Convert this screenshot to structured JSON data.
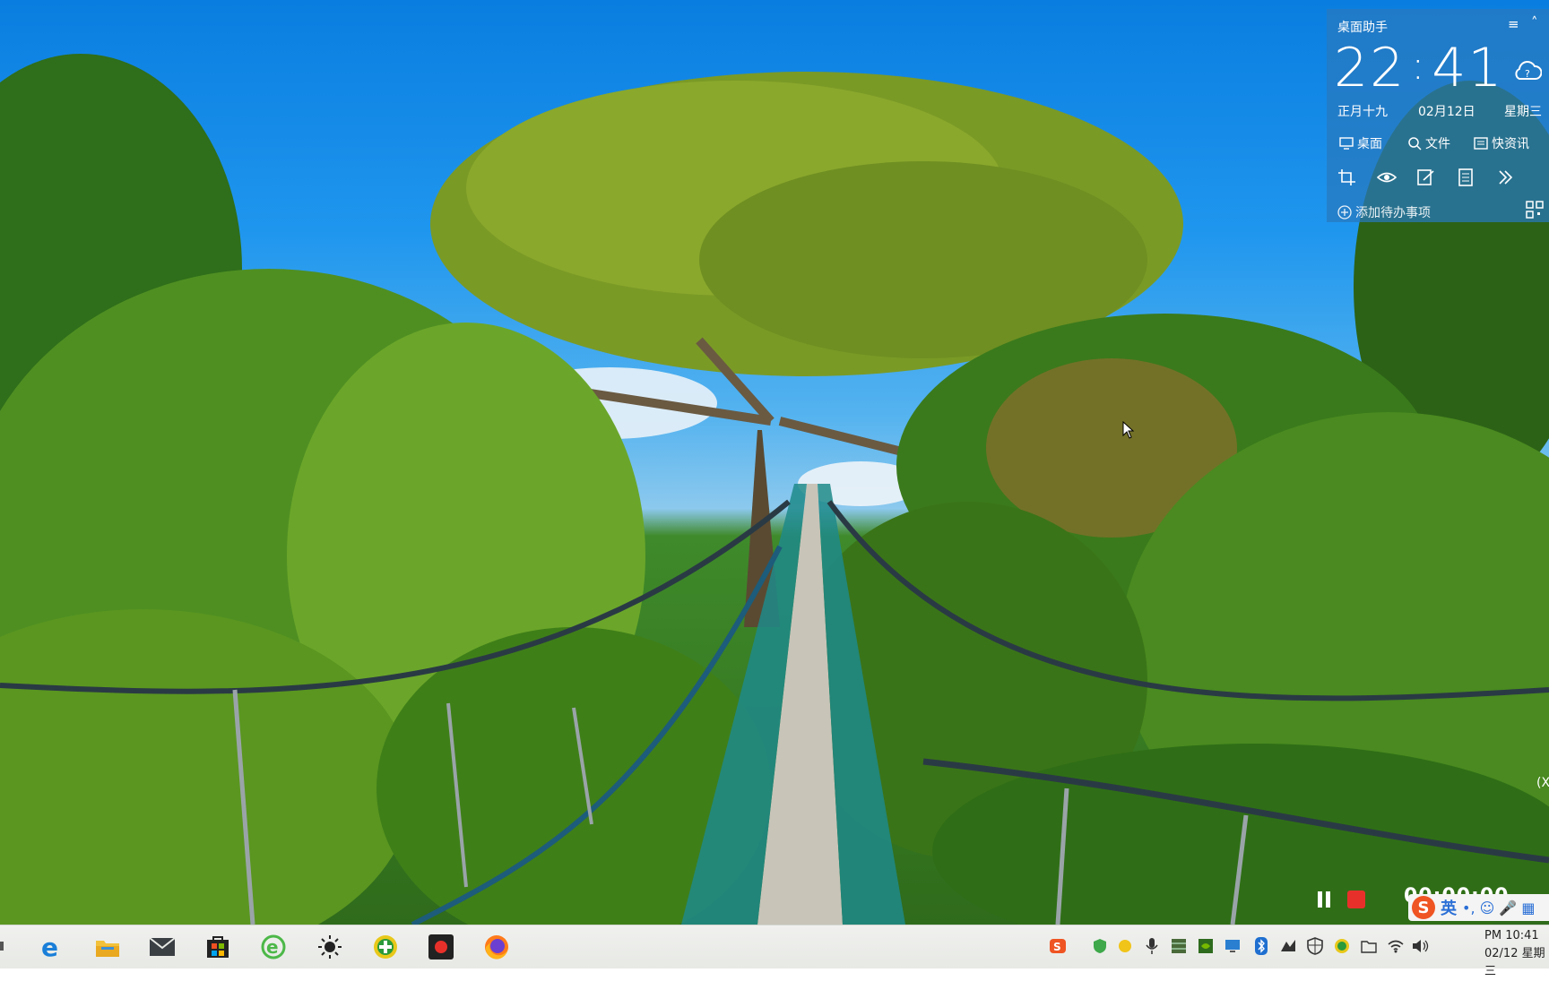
{
  "widget": {
    "title": "桌面助手",
    "menu_icon": "menu-icon",
    "collapse_icon": "chevron-up-icon",
    "time_hour": "22",
    "time_sep": ":",
    "time_minute": "41",
    "lunar_date": "正月十九",
    "date": "02月12日",
    "weekday": "星期三",
    "weather_icon": "cloud-question-icon",
    "quick_links": [
      {
        "label": "桌面",
        "icon": "monitor-icon"
      },
      {
        "label": "文件",
        "icon": "search-icon"
      },
      {
        "label": "快资讯",
        "icon": "news-icon"
      }
    ],
    "tools": [
      "crop-icon",
      "eye-icon",
      "edit-icon",
      "calculator-icon",
      "more-icon"
    ],
    "add_todo": "添加待办事项",
    "qr_icon": "qr-code-icon"
  },
  "recorder": {
    "time": "00:00:00",
    "pause_icon": "pause-icon",
    "stop_icon": "stop-icon"
  },
  "ime": {
    "logo": "S",
    "language": "英",
    "symbols": "•, ☺ 🎤 ▦"
  },
  "side_text": "(X",
  "taskbar": {
    "apps": [
      {
        "name": "edge",
        "icon": "ie-edge-icon"
      },
      {
        "name": "explorer",
        "icon": "file-explorer-icon"
      },
      {
        "name": "mail",
        "icon": "mail-icon"
      },
      {
        "name": "store",
        "icon": "store-icon"
      },
      {
        "name": "browser",
        "icon": "green-e-browser-icon"
      },
      {
        "name": "brightness",
        "icon": "sun-icon"
      },
      {
        "name": "game",
        "icon": "green-plus-icon"
      },
      {
        "name": "recorder",
        "icon": "red-record-icon"
      },
      {
        "name": "firefox",
        "icon": "firefox-icon"
      }
    ],
    "clock_time": "PM 10:41",
    "clock_date": "02/12 星期三"
  },
  "colors": {
    "widget_bg": "#2878be",
    "taskbar_bg": "#eceeea",
    "record_red": "#e8302a",
    "ime_blue": "#2a6fd6"
  }
}
